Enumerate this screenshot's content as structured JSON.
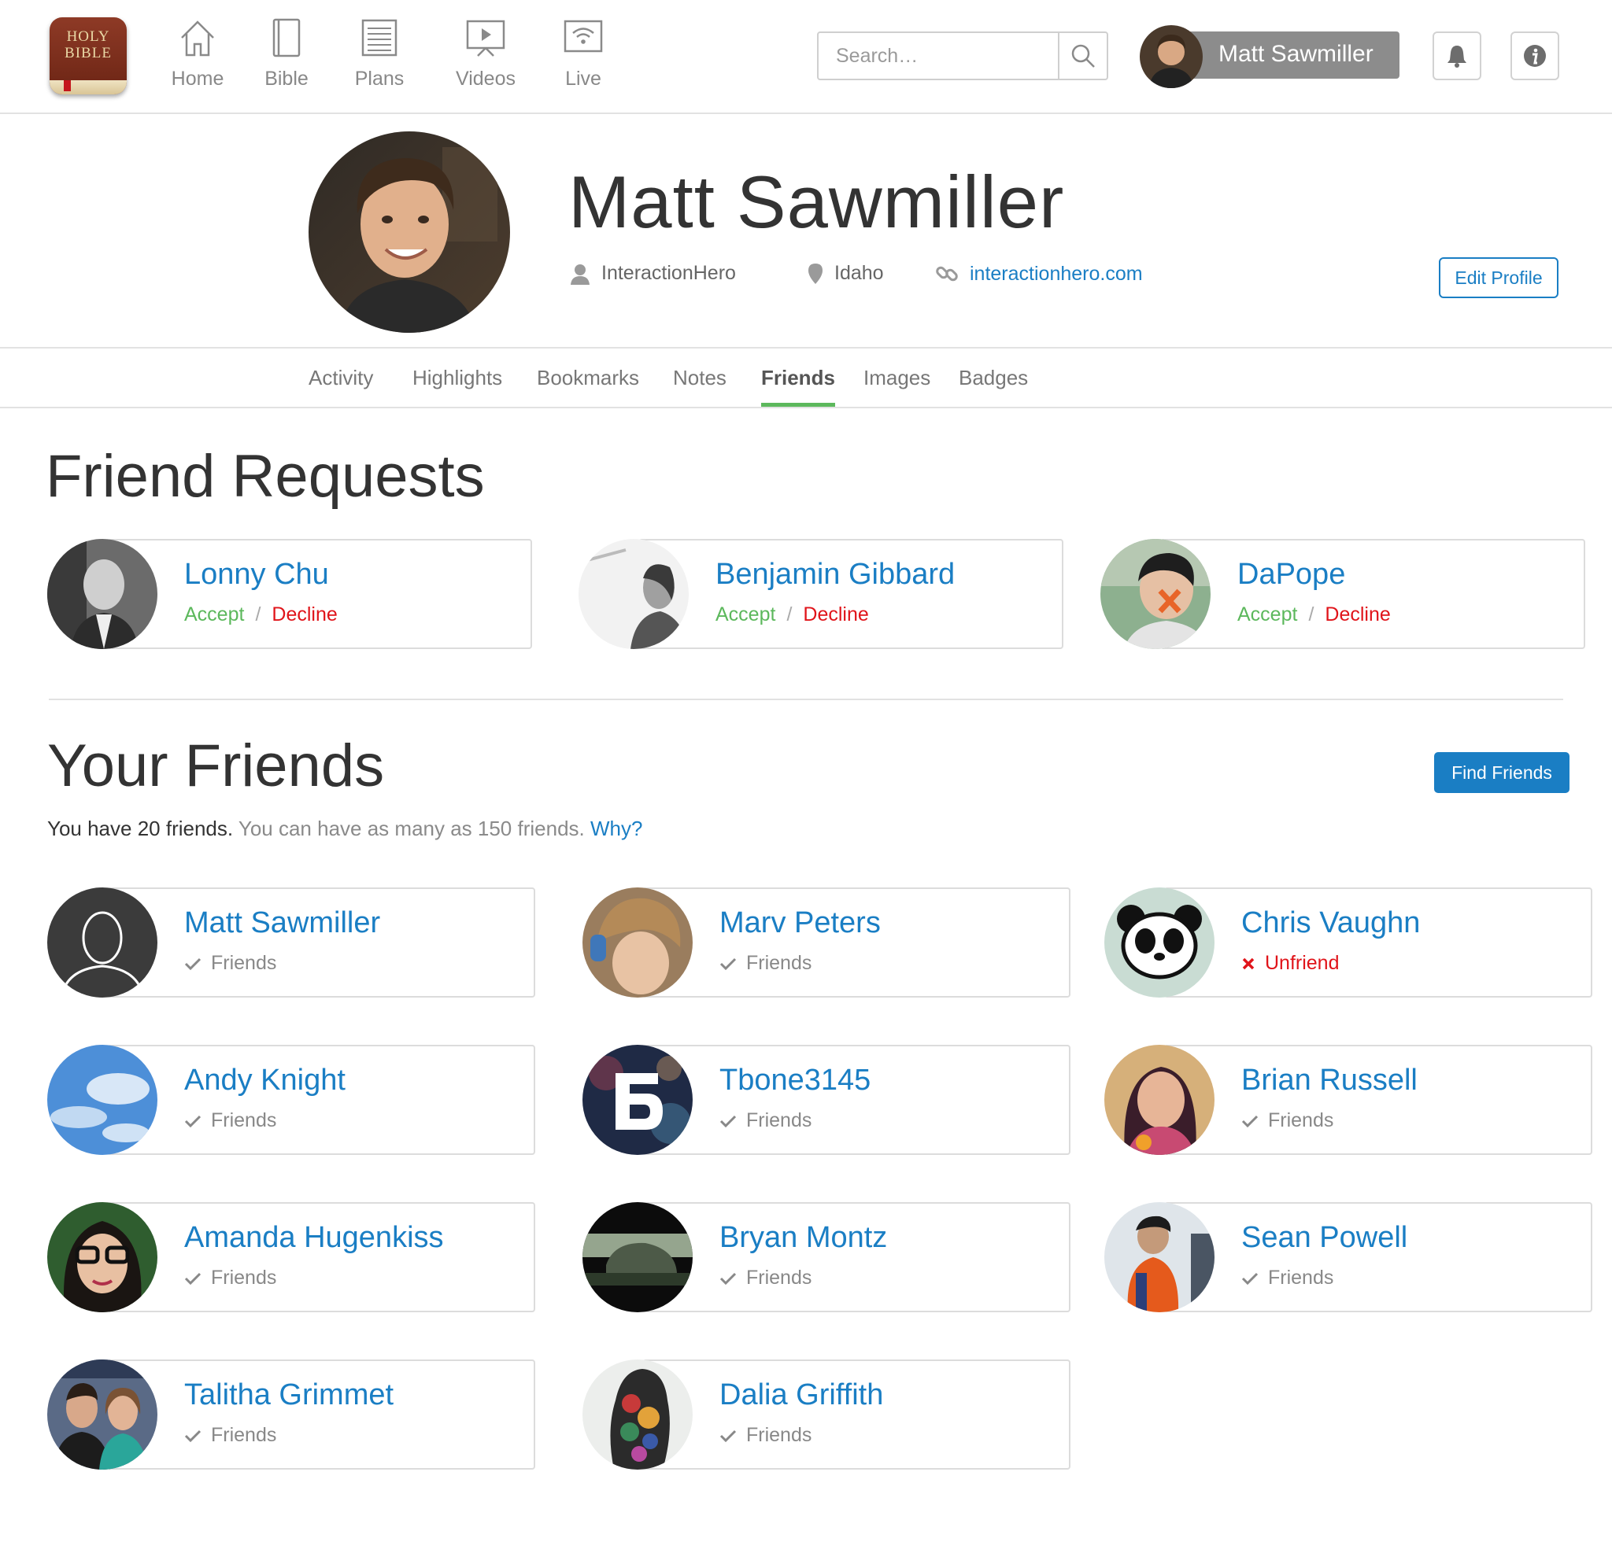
{
  "app": {
    "logo_text_line1": "HOLY",
    "logo_text_line2": "BIBLE"
  },
  "nav": {
    "items": [
      {
        "label": "Home",
        "icon": "home-icon"
      },
      {
        "label": "Bible",
        "icon": "bible-icon"
      },
      {
        "label": "Plans",
        "icon": "plans-icon"
      },
      {
        "label": "Videos",
        "icon": "videos-icon"
      },
      {
        "label": "Live",
        "icon": "live-icon"
      }
    ]
  },
  "search": {
    "placeholder": "Search…",
    "value": ""
  },
  "user": {
    "name": "Matt Sawmiller"
  },
  "profile": {
    "name": "Matt Sawmiller",
    "username": "InteractionHero",
    "location": "Idaho",
    "website": "interactionhero.com",
    "edit_label": "Edit Profile"
  },
  "tabs": [
    {
      "label": "Activity"
    },
    {
      "label": "Highlights"
    },
    {
      "label": "Bookmarks"
    },
    {
      "label": "Notes"
    },
    {
      "label": "Friends",
      "active": true
    },
    {
      "label": "Images"
    },
    {
      "label": "Badges"
    }
  ],
  "requests": {
    "title": "Friend Requests",
    "accept_label": "Accept",
    "decline_label": "Decline",
    "separator": "/",
    "items": [
      {
        "name": "Lonny Chu"
      },
      {
        "name": "Benjamin Gibbard"
      },
      {
        "name": "DaPope"
      }
    ]
  },
  "friends": {
    "title": "Your Friends",
    "find_label": "Find Friends",
    "count_text": "You have 20 friends.",
    "limit_text": "You can have as many as 150 friends.",
    "why_label": "Why?",
    "friends_status": "Friends",
    "unfriend_label": "Unfriend",
    "items": [
      {
        "name": "Matt Sawmiller",
        "status": "Friends"
      },
      {
        "name": "Marv Peters",
        "status": "Friends"
      },
      {
        "name": "Chris Vaughn",
        "status": "Unfriend"
      },
      {
        "name": "Andy Knight",
        "status": "Friends"
      },
      {
        "name": "Tbone3145",
        "status": "Friends"
      },
      {
        "name": "Brian Russell",
        "status": "Friends"
      },
      {
        "name": "Amanda Hugenkiss",
        "status": "Friends"
      },
      {
        "name": "Bryan Montz",
        "status": "Friends"
      },
      {
        "name": "Sean Powell",
        "status": "Friends"
      },
      {
        "name": "Talitha Grimmet",
        "status": "Friends"
      },
      {
        "name": "Dalia Griffith",
        "status": "Friends"
      }
    ]
  },
  "colors": {
    "link_blue": "#1a7ec4",
    "accept_green": "#5cb85c",
    "decline_red": "#e0141a",
    "active_tab_underline": "#5cb85c"
  }
}
